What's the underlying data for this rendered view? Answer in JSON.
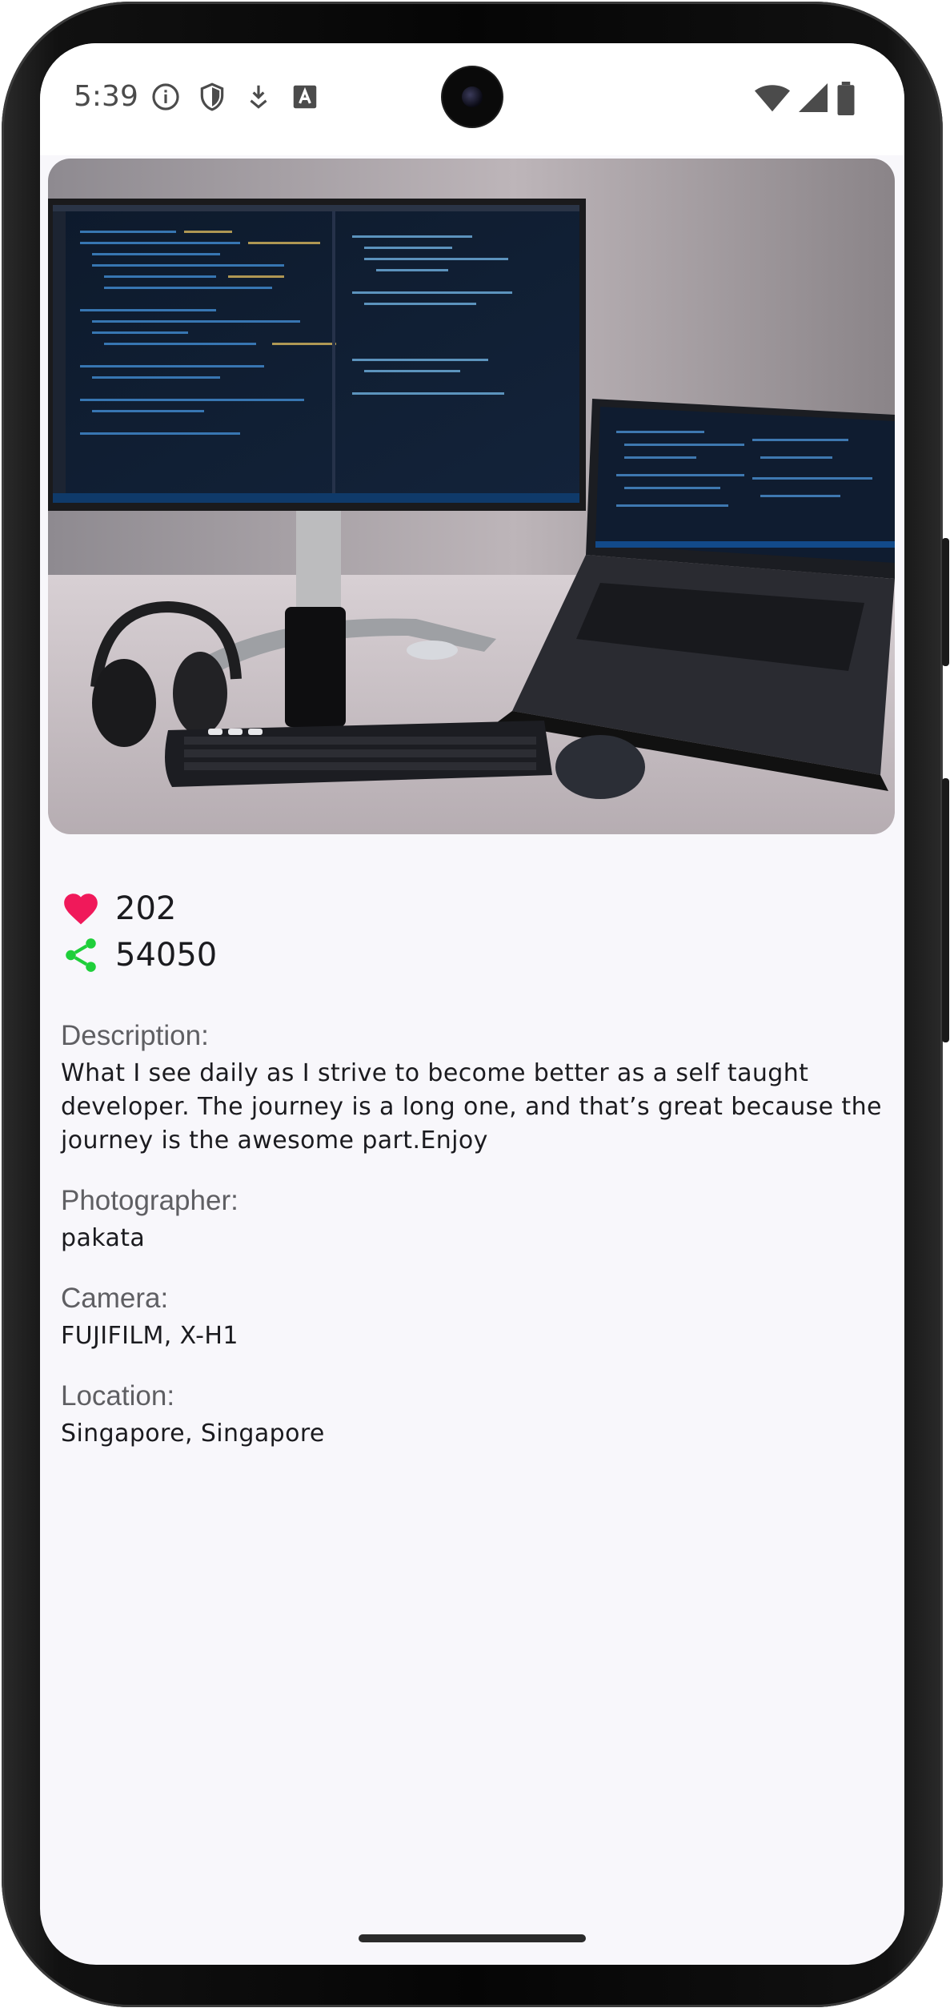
{
  "status_bar": {
    "time": "5:39",
    "icons_left": [
      "info-icon",
      "shield-icon",
      "download-icon",
      "font-a-icon"
    ],
    "icons_right": [
      "wifi-icon",
      "signal-icon",
      "battery-icon"
    ]
  },
  "photo": {
    "subject": "desk-setup-image"
  },
  "stats": {
    "likes": "202",
    "shares": "54050",
    "like_color": "#f0195a",
    "share_color": "#1fcf3a"
  },
  "details": {
    "description_label": "Description:",
    "description": "What I see daily as I strive to become better as a self taught developer. The journey is a long one, and that’s great because the journey is the awesome part.Enjoy",
    "photographer_label": "Photographer:",
    "photographer": "pakata",
    "camera_label": "Camera:",
    "camera": "FUJIFILM, X-H1",
    "location_label": "Location:",
    "location": "Singapore, Singapore"
  }
}
